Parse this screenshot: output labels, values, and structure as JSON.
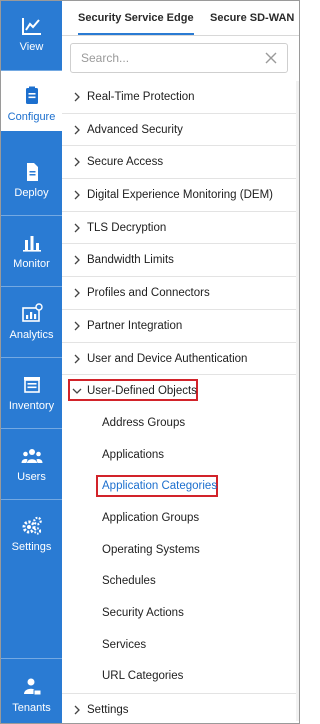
{
  "rail": {
    "items": [
      {
        "label": "View",
        "icon": "chart-icon"
      },
      {
        "label": "Configure",
        "icon": "clipboard-icon"
      },
      {
        "label": "Deploy",
        "icon": "file-icon"
      },
      {
        "label": "Monitor",
        "icon": "bar-chart-icon"
      },
      {
        "label": "Analytics",
        "icon": "analytics-icon"
      },
      {
        "label": "Inventory",
        "icon": "inventory-icon"
      },
      {
        "label": "Users",
        "icon": "users-icon"
      },
      {
        "label": "Settings",
        "icon": "gears-icon"
      },
      {
        "label": "Tenants",
        "icon": "tenant-icon"
      }
    ],
    "active": "Configure",
    "colors": {
      "rail": "#2a7bd3",
      "accent": "#1c6fce",
      "highlight": "#d2232a"
    }
  },
  "tabs": [
    {
      "label": "Security Service Edge"
    },
    {
      "label": "Secure SD-WAN"
    }
  ],
  "search": {
    "placeholder": "Search...",
    "value": ""
  },
  "menu": [
    {
      "label": "Real-Time Protection"
    },
    {
      "label": "Advanced Security"
    },
    {
      "label": "Secure Access"
    },
    {
      "label": "Digital Experience Monitoring (DEM)"
    },
    {
      "label": "TLS Decryption"
    },
    {
      "label": "Bandwidth Limits"
    },
    {
      "label": "Profiles and Connectors"
    },
    {
      "label": "Partner Integration"
    },
    {
      "label": "User and Device Authentication"
    },
    {
      "label": "User-Defined Objects"
    },
    {
      "label": "Settings"
    }
  ],
  "submenu": [
    {
      "label": "Address Groups"
    },
    {
      "label": "Applications"
    },
    {
      "label": "Application Categories"
    },
    {
      "label": "Application Groups"
    },
    {
      "label": "Operating Systems"
    },
    {
      "label": "Schedules"
    },
    {
      "label": "Security Actions"
    },
    {
      "label": "Services"
    },
    {
      "label": "URL Categories"
    }
  ]
}
